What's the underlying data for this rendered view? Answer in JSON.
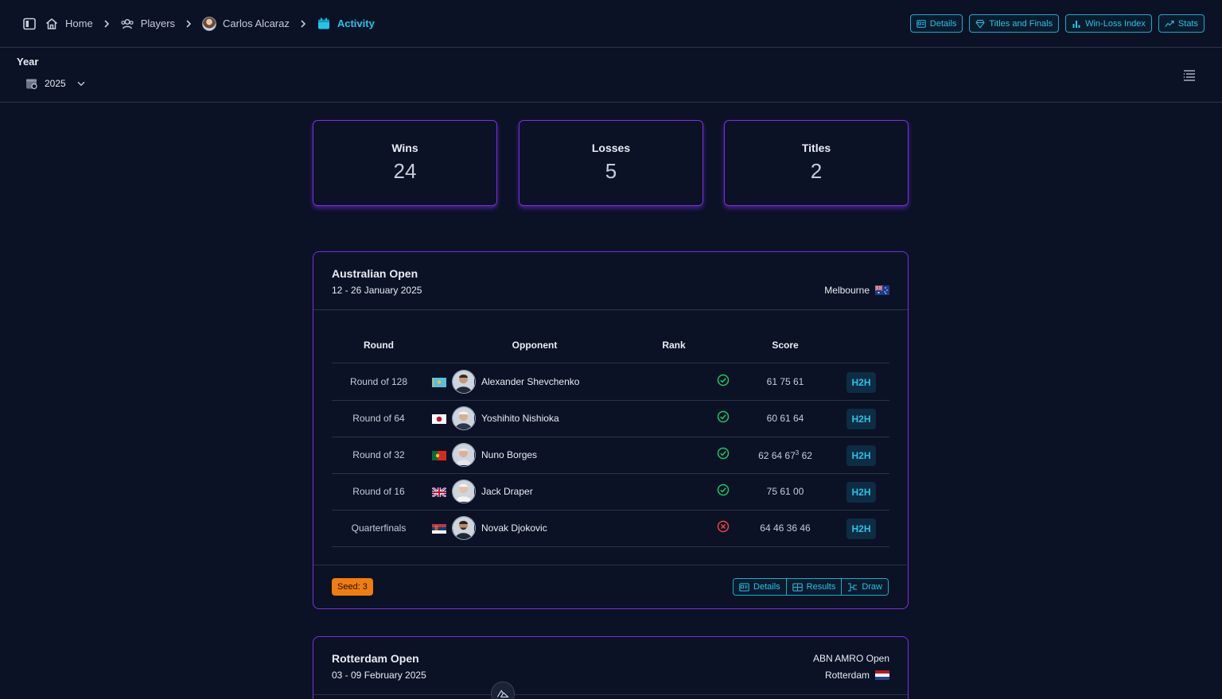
{
  "breadcrumb": {
    "home": "Home",
    "players": "Players",
    "player": "Carlos Alcaraz",
    "current": "Activity"
  },
  "top_actions": [
    "Details",
    "Titles and Finals",
    "Win-Loss Index",
    "Stats"
  ],
  "filters": {
    "year_label": "Year",
    "year_value": "2025"
  },
  "stats": [
    {
      "label": "Wins",
      "value": "24"
    },
    {
      "label": "Losses",
      "value": "5"
    },
    {
      "label": "Titles",
      "value": "2"
    }
  ],
  "tournaments": [
    {
      "name": "Australian Open",
      "dates": "12 - 26 January 2025",
      "city": "Melbourne",
      "flag": "AU",
      "columns": [
        "Round",
        "Opponent",
        "Rank",
        "Score"
      ],
      "matches": [
        {
          "round": "Round of 128",
          "flag": "KZ",
          "opponent": "Alexander Shevchenko",
          "result": "win",
          "score": "61 75 61",
          "tiebreak": "",
          "score_end": "",
          "h2h": "H2H"
        },
        {
          "round": "Round of 64",
          "flag": "JP",
          "opponent": "Yoshihito Nishioka",
          "result": "win",
          "score": "60 61 64",
          "tiebreak": "",
          "score_end": "",
          "h2h": "H2H"
        },
        {
          "round": "Round of 32",
          "flag": "PT",
          "opponent": "Nuno Borges",
          "result": "win",
          "score": "62 64 67",
          "tiebreak": "3",
          "score_end": " 62",
          "h2h": "H2H"
        },
        {
          "round": "Round of 16",
          "flag": "GB",
          "opponent": "Jack Draper",
          "result": "win",
          "score": "75 61 00",
          "tiebreak": "",
          "score_end": "",
          "h2h": "H2H"
        },
        {
          "round": "Quarterfinals",
          "flag": "RS",
          "opponent": "Novak Djokovic",
          "result": "loss",
          "score": "64 46 36 46",
          "tiebreak": "",
          "score_end": "",
          "h2h": "H2H"
        }
      ],
      "seed": "Seed: 3",
      "footer_buttons": [
        "Details",
        "Results",
        "Draw"
      ]
    },
    {
      "name": "Rotterdam Open",
      "sponsor": "ABN AMRO Open",
      "dates": "03 - 09 February 2025",
      "city": "Rotterdam",
      "flag": "NL"
    }
  ],
  "colors": {
    "accent": "#27c3e6",
    "card_border": "#7c2ee0",
    "win": "#22c55e",
    "loss": "#ef4444",
    "seed_bg": "#f07d0e"
  }
}
